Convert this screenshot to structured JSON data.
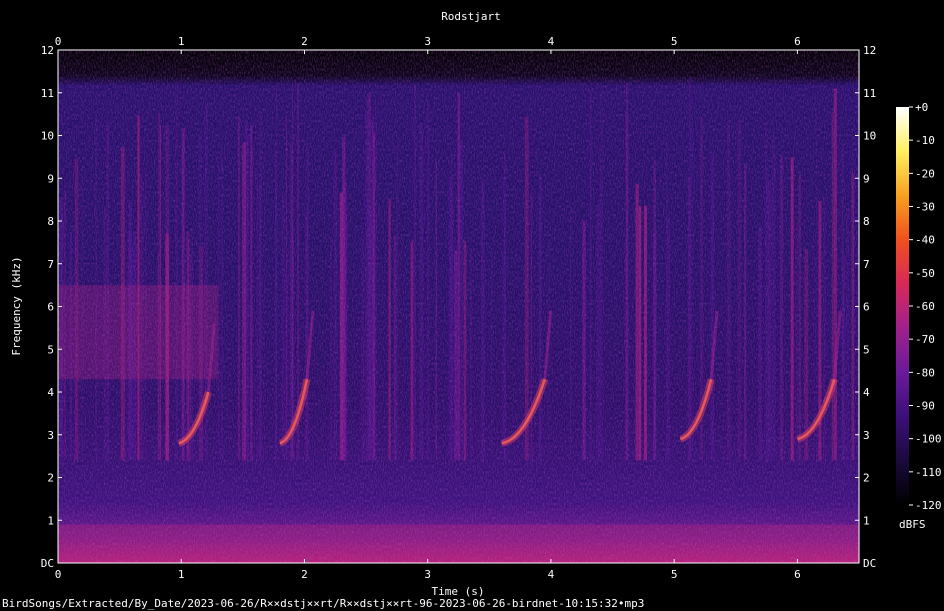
{
  "chart_data": {
    "type": "heatmap",
    "title": "Rodstjart",
    "xlabel": "Time (s)",
    "ylabel": "Frequency (kHz)",
    "xlim": [
      0,
      6.5
    ],
    "ylim": [
      0,
      12
    ],
    "x_ticks": [
      "0",
      "1",
      "2",
      "3",
      "4",
      "5",
      "6"
    ],
    "y_ticks": [
      "DC",
      "1",
      "2",
      "3",
      "4",
      "5",
      "6",
      "7",
      "8",
      "9",
      "10",
      "11",
      "12"
    ],
    "colorbar": {
      "label": "dBFS",
      "range": [
        -120,
        0
      ],
      "ticks": [
        "+0",
        "-10",
        "-20",
        "-30",
        "-40",
        "-50",
        "-60",
        "-70",
        "-80",
        "-90",
        "-100",
        "-110",
        "-120"
      ]
    },
    "colormap": [
      "#000000",
      "#1a0a3c",
      "#3c0f7a",
      "#6a1a9a",
      "#a0208c",
      "#d8285a",
      "#f0501e",
      "#f8a020",
      "#fff060",
      "#ffffff"
    ],
    "calls": [
      {
        "start_s": 0.98,
        "end_s": 1.22,
        "low_khz": 2.8,
        "high_khz": 4.0
      },
      {
        "start_s": 1.8,
        "end_s": 2.02,
        "low_khz": 2.8,
        "high_khz": 4.3
      },
      {
        "start_s": 3.6,
        "end_s": 3.95,
        "low_khz": 2.8,
        "high_khz": 4.3
      },
      {
        "start_s": 5.05,
        "end_s": 5.3,
        "low_khz": 2.9,
        "high_khz": 4.3
      },
      {
        "start_s": 6.0,
        "end_s": 6.3,
        "low_khz": 2.9,
        "high_khz": 4.3
      }
    ]
  },
  "footer": {
    "filename": "BirdSongs/Extracted/By_Date/2023-06-26/R××dstj××rt/R××dstj××rt-96-2023-06-26-birdnet-10:15:32•mp3"
  }
}
